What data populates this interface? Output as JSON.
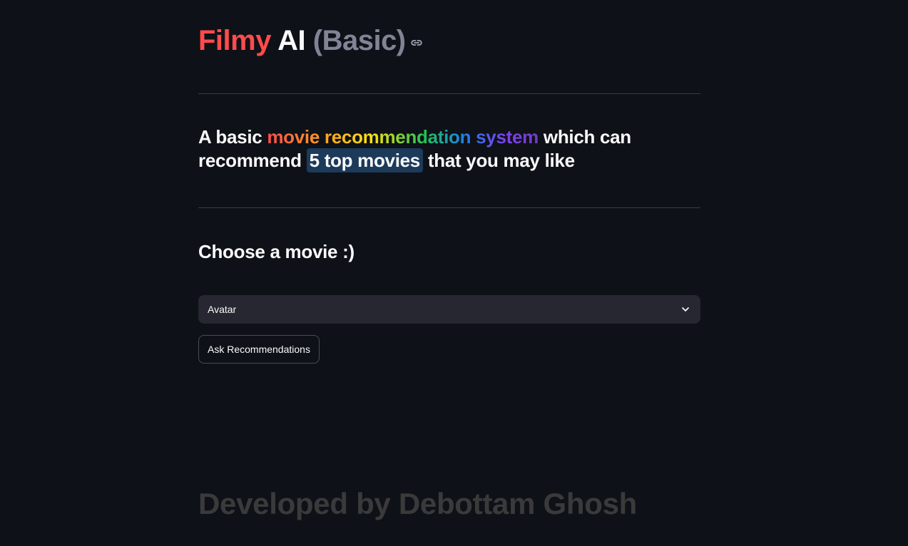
{
  "header": {
    "title_part1": "Filmy",
    "title_part2": "AI",
    "title_part3": "(Basic)",
    "anchor_icon": "link-icon"
  },
  "tagline": {
    "lead": "A basic",
    "rainbow": "movie recommendation system",
    "mid": "which can recommend",
    "highlight": "5 top movies",
    "tail": "that you may like"
  },
  "selector": {
    "label": "Choose a movie :)",
    "selected_value": "Avatar",
    "icon": "chevron-down-icon"
  },
  "actions": {
    "recommend_button_label": "Ask Recommendations"
  },
  "footer": {
    "credit": "Developed by Debottam Ghosh"
  },
  "colors": {
    "background": "#0e1117",
    "accent_red": "#ff4b4b",
    "muted_gray": "#808495",
    "highlight_bg": "#1c3a5a",
    "select_bg": "#262730",
    "footer_text": "#3a3a3a"
  }
}
